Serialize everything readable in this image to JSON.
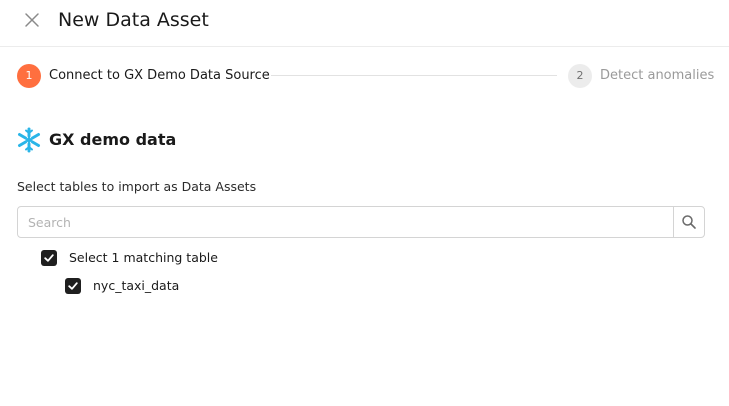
{
  "header": {
    "title": "New Data Asset"
  },
  "stepper": {
    "steps": [
      {
        "number": "1",
        "label": "Connect to GX Demo Data Source",
        "state": "active"
      },
      {
        "number": "2",
        "label": "Detect anomalies",
        "state": "pending"
      }
    ]
  },
  "source": {
    "icon": "snowflake-icon",
    "name": "GX demo data"
  },
  "tables": {
    "instruction": "Select tables to import as Data Assets",
    "search": {
      "placeholder": "Search",
      "value": ""
    },
    "select_all": {
      "label": "Select 1 matching table",
      "checked": true
    },
    "items": [
      {
        "label": "nyc_taxi_data",
        "checked": true
      }
    ]
  },
  "colors": {
    "accent": "#ff6f3f",
    "snowflake": "#29b5e8",
    "checkbox": "#1f1f1f"
  }
}
